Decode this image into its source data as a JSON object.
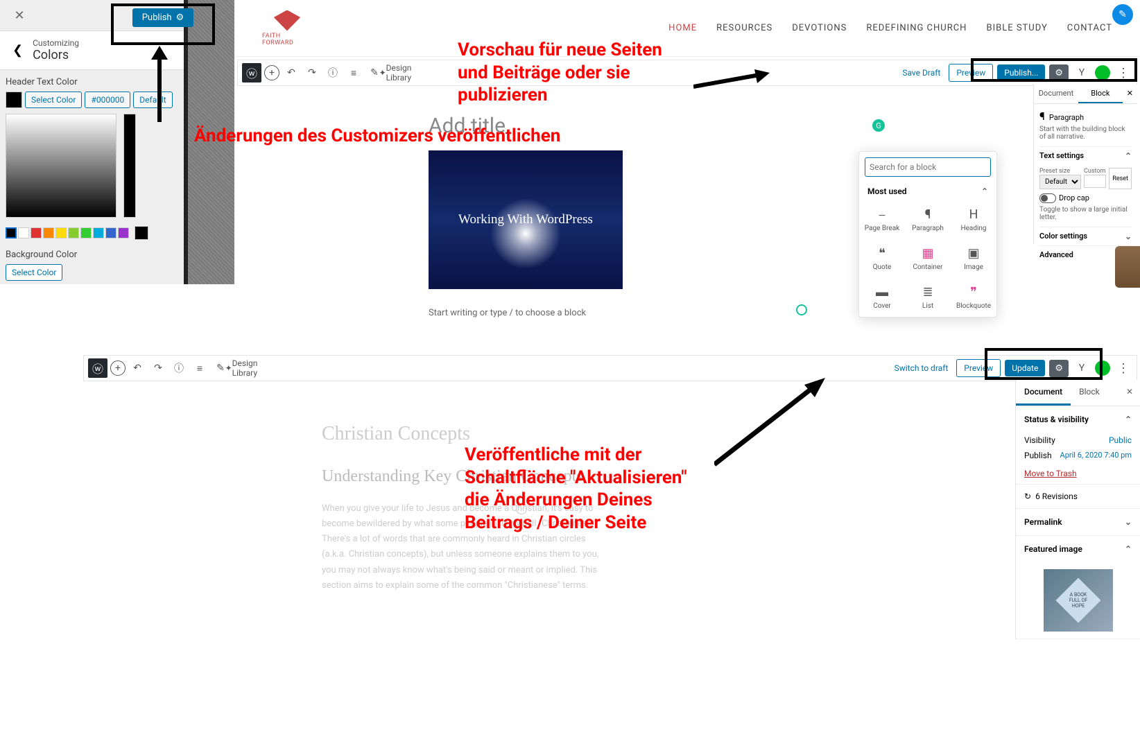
{
  "customizer": {
    "publish": "Publish",
    "customizing": "Customizing",
    "section": "Colors",
    "header_label": "Header Text Color",
    "select_color": "Select Color",
    "hex": "#000000",
    "default": "Default",
    "swatches": [
      "#000000",
      "#ffffff",
      "#d33",
      "#f80",
      "#fd0",
      "#8c3",
      "#3c3",
      "#0ad",
      "#36c",
      "#93c"
    ],
    "bg_label": "Background Color"
  },
  "annotations": {
    "a1": "Änderungen des Customizers veröffentlichen",
    "a2": "Vorschau für neue Seiten und Beiträge oder sie publizieren",
    "a3": "Veröffentliche mit der Schaltfläche \"Aktualisieren\" die Änderungen Deines Beitrags / Deiner Seite"
  },
  "site": {
    "logo_text": "FAITH FORWARD",
    "nav": [
      "Home",
      "Resources",
      "Devotions",
      "Redefining Church",
      "Bible Study",
      "Contact"
    ]
  },
  "editor_top": {
    "design_library": "Design Library",
    "save_draft": "Save Draft",
    "preview": "Preview",
    "publish": "Publish...",
    "add_title": "Add title",
    "hero": "Working With WordPress",
    "start_writing": "Start writing or type / to choose a block"
  },
  "inserter": {
    "search_placeholder": "Search for a block",
    "most_used": "Most used",
    "items": [
      "Page Break",
      "Paragraph",
      "Heading",
      "Quote",
      "Container",
      "Image",
      "Cover",
      "List",
      "Blockquote"
    ]
  },
  "block_sidebar": {
    "tab_doc": "Document",
    "tab_block": "Block",
    "paragraph": "Paragraph",
    "desc": "Start with the building block of all narrative.",
    "text_settings": "Text settings",
    "preset": "Preset size",
    "default_opt": "Default",
    "custom": "Custom",
    "reset": "Reset",
    "drop_cap": "Drop cap",
    "drop_cap_desc": "Toggle to show a large initial letter.",
    "color_settings": "Color settings",
    "advanced": "Advanced"
  },
  "editor_bottom": {
    "switch_to_draft": "Switch to draft",
    "preview": "Preview",
    "update": "Update",
    "design_library": "Design Library",
    "eyebrow": "Christian Concepts",
    "title": "Understanding Key Christian Concepts",
    "body": "When you give your life to Jesus and become a Christian, it's easy to become bewildered by what some people jokingly call \"Christianese.\" There's a lot of words that are commonly heard in Christian circles (a.k.a. Christian concepts), but unless someone explains them to you, you may not always know what's being said or meant or implied. This section aims to explain some of the common \"Christianese\" terms."
  },
  "doc_sidebar": {
    "tab_doc": "Document",
    "tab_block": "Block",
    "status": "Status & visibility",
    "visibility": "Visibility",
    "visibility_val": "Public",
    "publish": "Publish",
    "publish_val": "April 6, 2020 7:40 pm",
    "trash": "Move to Trash",
    "revisions": "6 Revisions",
    "permalink": "Permalink",
    "featured": "Featured image",
    "book_text": "A BOOK FULL OF HOPE"
  }
}
